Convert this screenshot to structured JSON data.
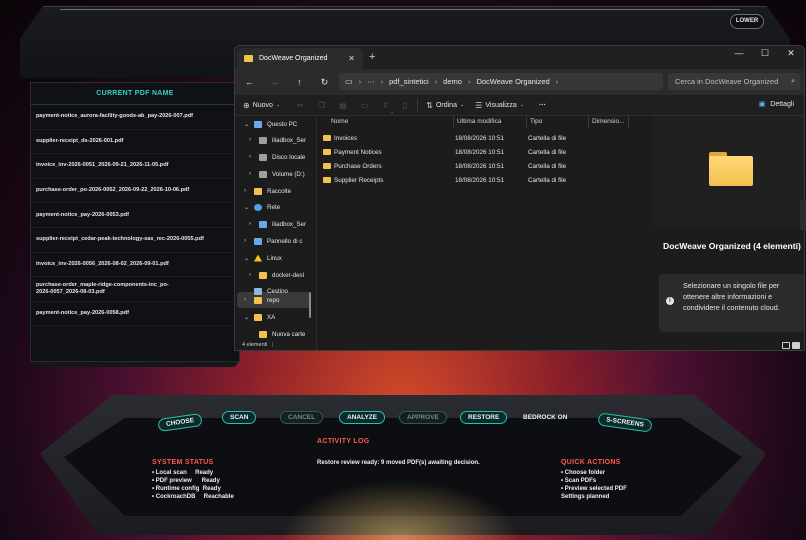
{
  "console": {
    "lower_label": "LOWER",
    "pdf_list_header": "CURRENT PDF NAME",
    "pdf_items": [
      "payment-notice_aurora-facility-goods-ab_pay-2026-007.pdf",
      "supplier-receipt_ds-2026-001.pdf",
      "invoice_inv-2026-0051_2026-09-21_2026-11-05.pdf",
      "purchase-order_po-2026-0052_2026-09-22_2026-10-06.pdf",
      "payment-notice_pay-2026-0053.pdf",
      "supplier-receipt_cedar-peak-technology-sas_rec-2026-0055.pdf",
      "invoice_inv-2026-0056_2026-08-02_2026-09-01.pdf",
      "purchase-order_maple-ridge-components-inc_po-2026-0057_2026-08-03.pdf",
      "payment-notice_pay-2026-0058.pdf"
    ],
    "buttons": [
      {
        "label": "CHOOSE",
        "enabled": true
      },
      {
        "label": "SCAN",
        "enabled": true
      },
      {
        "label": "CANCEL",
        "enabled": false
      },
      {
        "label": "ANALYZE",
        "enabled": true
      },
      {
        "label": "APPROVE",
        "enabled": false
      },
      {
        "label": "RESTORE",
        "enabled": true
      },
      {
        "label": "BEDROCK ON",
        "enabled": true
      },
      {
        "label": "S-SCREENS",
        "enabled": true
      }
    ],
    "activity_log_title": "ACTIVITY LOG",
    "activity_log_text": "Restore review ready: 9 moved PDF(s) awaiting decision.",
    "system_status_title": "SYSTEM STATUS",
    "system_status": [
      {
        "key": "• Local scan",
        "value": "Ready"
      },
      {
        "key": "• PDF preview",
        "value": "Ready"
      },
      {
        "key": "• Runtime config",
        "value": "Ready"
      },
      {
        "key": "• CockroachDB",
        "value": "Reachable"
      }
    ],
    "quick_actions_title": "QUICK ACTIONS",
    "quick_actions": [
      "• Choose folder",
      "• Scan PDFs",
      "• Preview selected PDF",
      "Settings planned"
    ],
    "accent_color": "#2bbfb0",
    "alert_color": "#ff5a4a"
  },
  "explorer": {
    "tab_title": "DocWeave Organized",
    "new_tab": "+",
    "window_controls": {
      "minimize": "—",
      "maximize": "☐",
      "close": "✕"
    },
    "nav_icons": [
      "arrow-left",
      "arrow-right",
      "arrow-up",
      "refresh"
    ],
    "breadcrumb": [
      "pdf_sintetici",
      "demo",
      "DocWeave Organized"
    ],
    "breadcrumb_more": "···",
    "search_placeholder": "Cerca in DocWeave Organized",
    "toolbar": {
      "new_label": "Nuovo",
      "sort_label": "Ordina",
      "view_label": "Visualizza",
      "more_label": "···",
      "details_label": "Dettagli"
    },
    "tree": [
      {
        "label": "Questo PC",
        "icon": "pc",
        "indent": 0,
        "chev": "⌄"
      },
      {
        "label": "iliadbox_Ser",
        "icon": "drive",
        "indent": 1,
        "chev": "›"
      },
      {
        "label": "Disco locale",
        "icon": "drive",
        "indent": 1,
        "chev": "›"
      },
      {
        "label": "Volume (D:)",
        "icon": "drive",
        "indent": 1,
        "chev": "›"
      },
      {
        "label": "Raccolte",
        "icon": "folder",
        "indent": 0,
        "chev": "›"
      },
      {
        "label": "Rete",
        "icon": "net",
        "indent": 0,
        "chev": "⌄"
      },
      {
        "label": "iliadbox_Ser",
        "icon": "pc",
        "indent": 1,
        "chev": "›"
      },
      {
        "label": "Pannello di c",
        "icon": "pc",
        "indent": 0,
        "chev": "›"
      },
      {
        "label": "Linux",
        "icon": "linux",
        "indent": 0,
        "chev": "⌄"
      },
      {
        "label": "docker-desl",
        "icon": "folder",
        "indent": 1,
        "chev": "›"
      },
      {
        "label": "Cestino",
        "icon": "trash",
        "indent": 0,
        "chev": ""
      },
      {
        "label": "repo",
        "icon": "folder",
        "indent": 0,
        "chev": "›"
      },
      {
        "label": "XA",
        "icon": "folder",
        "indent": 0,
        "chev": "⌄"
      },
      {
        "label": "Nuova carte",
        "icon": "folder",
        "indent": 1,
        "chev": ""
      }
    ],
    "selected_tree_item": "repo",
    "columns": {
      "name": "Nome",
      "modified": "Ultima modifica",
      "type": "Tipo",
      "size": "Dimensio..."
    },
    "files": [
      {
        "name": "Invoices",
        "modified": "18/08/2026 10:51",
        "type": "Cartella di file"
      },
      {
        "name": "Payment Notices",
        "modified": "18/08/2026 10:51",
        "type": "Cartella di file"
      },
      {
        "name": "Purchase Orders",
        "modified": "18/08/2026 10:51",
        "type": "Cartella di file"
      },
      {
        "name": "Supplier Receipts",
        "modified": "18/08/2026 10:51",
        "type": "Cartella di file"
      }
    ],
    "preview_title": "DocWeave Organized (4 elementi)",
    "preview_info": "Selezionare un singolo file per ottenere altre informazioni e condividere il contenuto cloud.",
    "status_count": "4 elementi",
    "status_sep": "|"
  }
}
